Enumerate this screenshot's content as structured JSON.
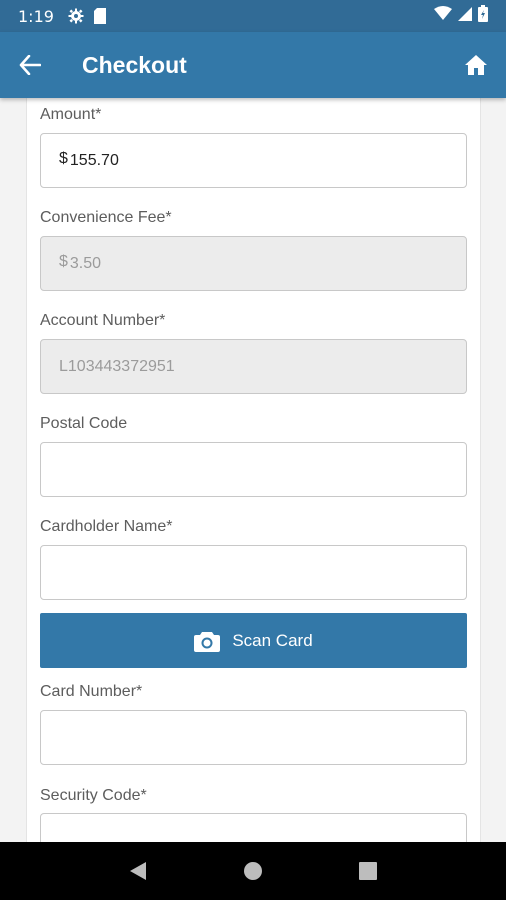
{
  "status_bar": {
    "time": "1:19",
    "icons": [
      "gear-icon",
      "sd-card-icon",
      "wifi-icon",
      "signal-icon",
      "battery-icon"
    ]
  },
  "app_bar": {
    "title": "Checkout"
  },
  "form": {
    "amount": {
      "label": "Amount*",
      "currency": "$",
      "value": "155.70"
    },
    "fee": {
      "label": "Convenience Fee*",
      "currency": "$",
      "value": "3.50"
    },
    "account": {
      "label": "Account Number*",
      "value": "L103443372951"
    },
    "postal": {
      "label": "Postal Code",
      "value": ""
    },
    "cardholder": {
      "label": "Cardholder Name*",
      "value": ""
    },
    "scan_button": {
      "label": "Scan Card"
    },
    "card_number": {
      "label": "Card Number*",
      "value": ""
    },
    "security_code": {
      "label": "Security Code*",
      "value": ""
    }
  },
  "colors": {
    "app_bar": "#3378a8",
    "status_bar": "#316b96",
    "button": "#3378a8"
  }
}
